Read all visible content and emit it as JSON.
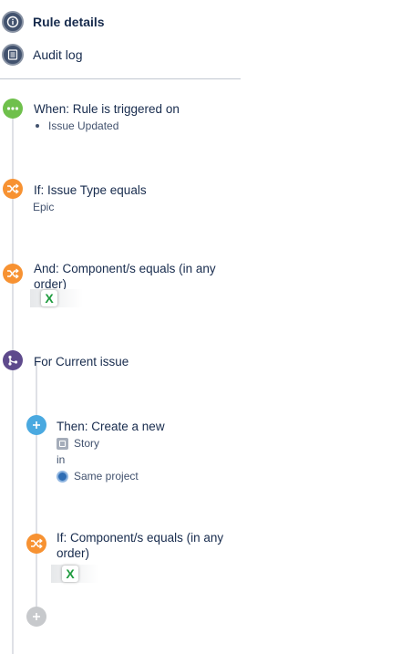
{
  "nav": {
    "rule_details": {
      "label": "Rule details",
      "icon": "info-icon"
    },
    "audit_log": {
      "label": "Audit log",
      "icon": "list-icon"
    }
  },
  "steps": {
    "trigger": {
      "title": "When: Rule is triggered on",
      "items": [
        "Issue Updated"
      ],
      "icon": "more-dots-icon",
      "color": "#6fc04c"
    },
    "condition_issue_type": {
      "title": "If: Issue Type equals",
      "value": "Epic",
      "icon": "shuffle-icon",
      "color": "#f79232"
    },
    "condition_component": {
      "title_line1": "And: Component/s equals (in any",
      "title_line2": "order)",
      "chip_letter": "X",
      "icon": "shuffle-icon",
      "color": "#f79232"
    },
    "branch": {
      "title": "For Current issue",
      "icon": "branch-icon",
      "color": "#5e4a8c"
    },
    "action_create": {
      "title": "Then: Create a new",
      "issue_type": "Story",
      "connector": "in",
      "project": "Same project",
      "icon": "plus-icon",
      "color": "#4aa9e0"
    },
    "condition_component_2": {
      "title_line1": "If: Component/s equals (in any",
      "title_line2": "order)",
      "chip_letter": "X",
      "icon": "shuffle-icon",
      "color": "#f79232"
    },
    "add_component": {
      "icon": "plus-icon",
      "color": "#c7c9cc"
    }
  }
}
